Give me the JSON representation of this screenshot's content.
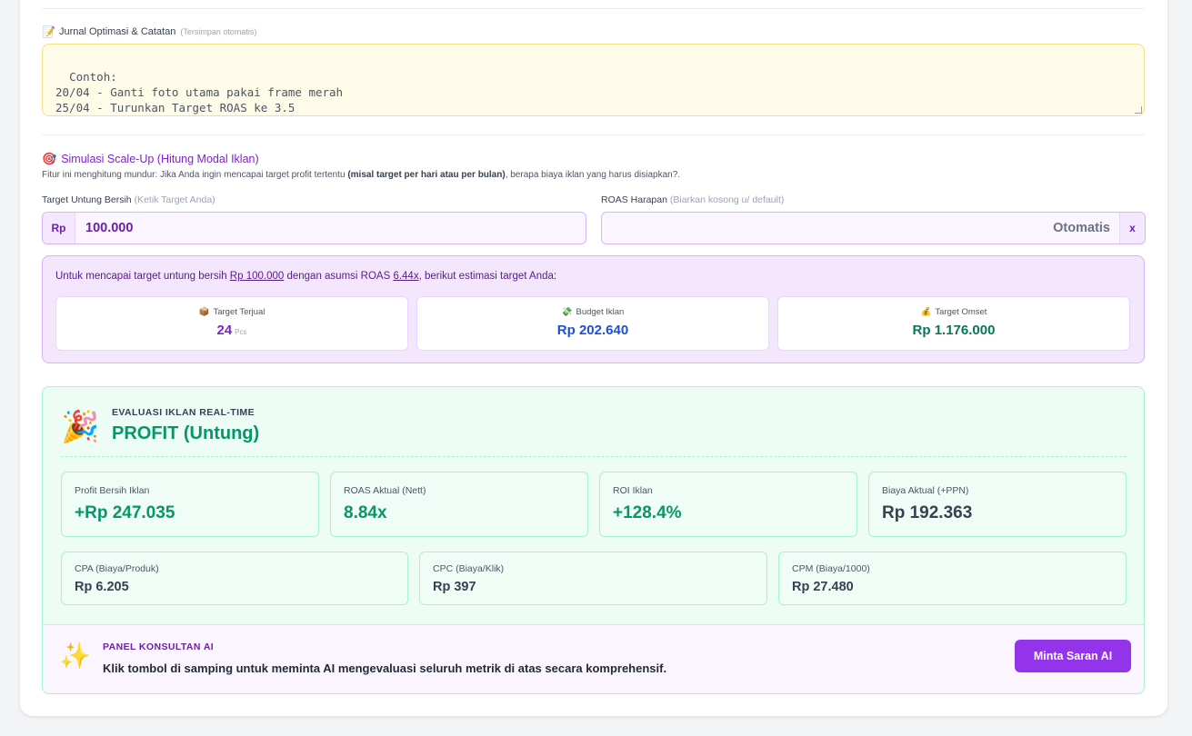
{
  "journal": {
    "icon": "memo-icon",
    "label": "Jurnal Optimasi & Catatan",
    "hint": "(Tersimpan otomatis)",
    "placeholder": "Contoh:\n20/04 - Ganti foto utama pakai frame merah\n25/04 - Turunkan Target ROAS ke 3.5"
  },
  "simulation": {
    "icon": "target-icon",
    "title": "Simulasi Scale-Up (Hitung Modal Iklan)",
    "desc_prefix": "Fitur ini menghitung mundur: Jika Anda ingin mencapai target profit tertentu ",
    "desc_bold": "(misal target per hari atau per bulan)",
    "desc_suffix": ", berapa biaya iklan yang harus disiapkan?.",
    "target_label": "Target Untung Bersih",
    "target_hint": "(Ketik Target Anda)",
    "target_prefix": "Rp",
    "target_value": "100.000",
    "roas_label": "ROAS Harapan",
    "roas_hint": "(Biarkan kosong u/ default)",
    "roas_placeholder": "Otomatis",
    "roas_clear": "x"
  },
  "estimate": {
    "text_1": "Untuk mencapai target untung bersih ",
    "target_amount": "Rp 100.000",
    "text_2": " dengan asumsi ROAS ",
    "roas": "6.44x",
    "text_3": ", berikut estimasi target Anda:",
    "cards": [
      {
        "icon": "package-icon",
        "label": "Target Terjual",
        "value": "24",
        "unit": "Pcs",
        "color": "#7e22ce"
      },
      {
        "icon": "money-icon",
        "label": "Budget Iklan",
        "value": "Rp 202.640",
        "unit": "",
        "color": "#1d4ed8"
      },
      {
        "icon": "money-bag-icon",
        "label": "Target Omset",
        "value": "Rp 1.176.000",
        "unit": "",
        "color": "#047857"
      }
    ]
  },
  "evaluation": {
    "icon": "party-popper-icon",
    "kicker": "EVALUASI IKLAN REAL-TIME",
    "status": "PROFIT (Untung)",
    "metrics": [
      {
        "label": "Profit Bersih Iklan",
        "value": "+Rp 247.035",
        "color": "#059669"
      },
      {
        "label": "ROAS Aktual (Nett)",
        "value": "8.84x",
        "color": "#059669"
      },
      {
        "label": "ROI Iklan",
        "value": "+128.4%",
        "color": "#059669"
      },
      {
        "label": "Biaya Aktual (+PPN)",
        "value": "Rp 192.363",
        "color": "#374151"
      }
    ],
    "small_metrics": [
      {
        "label": "CPA (Biaya/Produk)",
        "value": "Rp 6.205"
      },
      {
        "label": "CPC (Biaya/Klik)",
        "value": "Rp 397"
      },
      {
        "label": "CPM (Biaya/1000)",
        "value": "Rp 27.480"
      }
    ]
  },
  "ai_panel": {
    "icon": "sparkles-icon",
    "kicker": "PANEL KONSULTAN AI",
    "text": "Klik tombol di samping untuk meminta AI mengevaluasi seluruh metrik di atas secara komprehensif.",
    "button": "Minta Saran AI"
  }
}
